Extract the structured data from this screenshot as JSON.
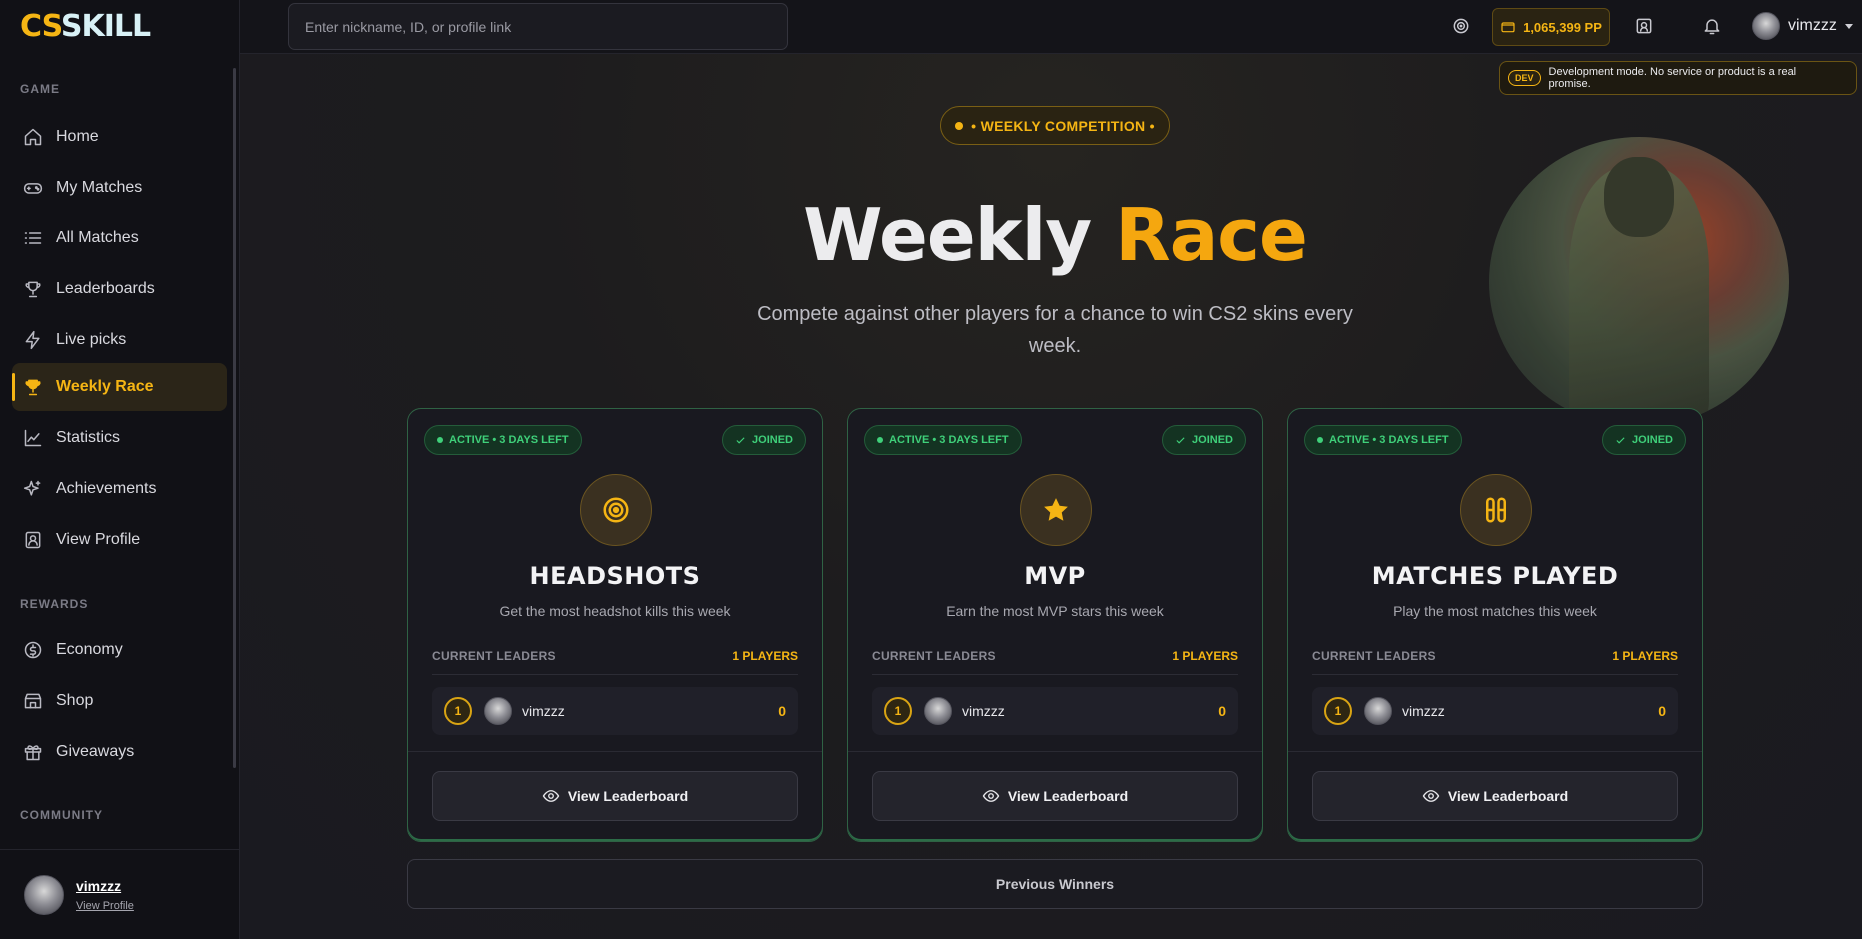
{
  "logo": {
    "part1": "CS",
    "part2": "SKILL"
  },
  "sidebar": {
    "sections": {
      "game": "GAME",
      "rewards": "REWARDS",
      "community": "COMMUNITY"
    },
    "items": [
      {
        "label": "Home",
        "icon": "home-icon"
      },
      {
        "label": "My Matches",
        "icon": "gamepad-icon"
      },
      {
        "label": "All Matches",
        "icon": "list-icon"
      },
      {
        "label": "Leaderboards",
        "icon": "trophy-outline-icon"
      },
      {
        "label": "Live picks",
        "icon": "lightning-icon"
      },
      {
        "label": "Weekly Race",
        "icon": "trophy-icon",
        "active": true
      },
      {
        "label": "Statistics",
        "icon": "chart-line-icon"
      },
      {
        "label": "Achievements",
        "icon": "sparkle-icon"
      },
      {
        "label": "View Profile",
        "icon": "profile-card-icon"
      }
    ],
    "reward_items": [
      {
        "label": "Economy",
        "icon": "coin-icon"
      },
      {
        "label": "Shop",
        "icon": "store-icon"
      },
      {
        "label": "Giveaways",
        "icon": "gift-icon"
      }
    ],
    "user": {
      "name": "vimzzz",
      "link": "View Profile"
    }
  },
  "topbar": {
    "search_placeholder": "Enter nickname, ID, or profile link",
    "balance": "1,065,399 PP",
    "username": "vimzzz"
  },
  "dev_notice": {
    "tag": "DEV",
    "message": "Development mode. No service or product is a real promise."
  },
  "hero": {
    "badge": "• WEEKLY COMPETITION •",
    "title_part1": "Weekly",
    "title_part2": "Race",
    "subtitle": "Compete against other players for a chance to win CS2 skins every week."
  },
  "cards": [
    {
      "status": "ACTIVE • 3 DAYS LEFT",
      "joined": "JOINED",
      "emblem": "target-icon",
      "title": "HEADSHOTS",
      "desc": "Get the most headshot kills this week",
      "leaders_label": "CURRENT LEADERS",
      "players": "1 PLAYERS",
      "rank": "1",
      "player": "vimzzz",
      "score": "0",
      "button": "View Leaderboard"
    },
    {
      "status": "ACTIVE • 3 DAYS LEFT",
      "joined": "JOINED",
      "emblem": "star-icon",
      "title": "MVP",
      "desc": "Earn the most MVP stars this week",
      "leaders_label": "CURRENT LEADERS",
      "players": "1 PLAYERS",
      "rank": "1",
      "player": "vimzzz",
      "score": "0",
      "button": "View Leaderboard"
    },
    {
      "status": "ACTIVE • 3 DAYS LEFT",
      "joined": "JOINED",
      "emblem": "matches-icon",
      "title": "MATCHES PLAYED",
      "desc": "Play the most matches this week",
      "leaders_label": "CURRENT LEADERS",
      "players": "1 PLAYERS",
      "rank": "1",
      "player": "vimzzz",
      "score": "0",
      "button": "View Leaderboard"
    }
  ],
  "previous_winners": "Previous Winners",
  "colors": {
    "accent": "#f5b514",
    "active_green": "#3fd07a",
    "background": "#1c1c22"
  }
}
